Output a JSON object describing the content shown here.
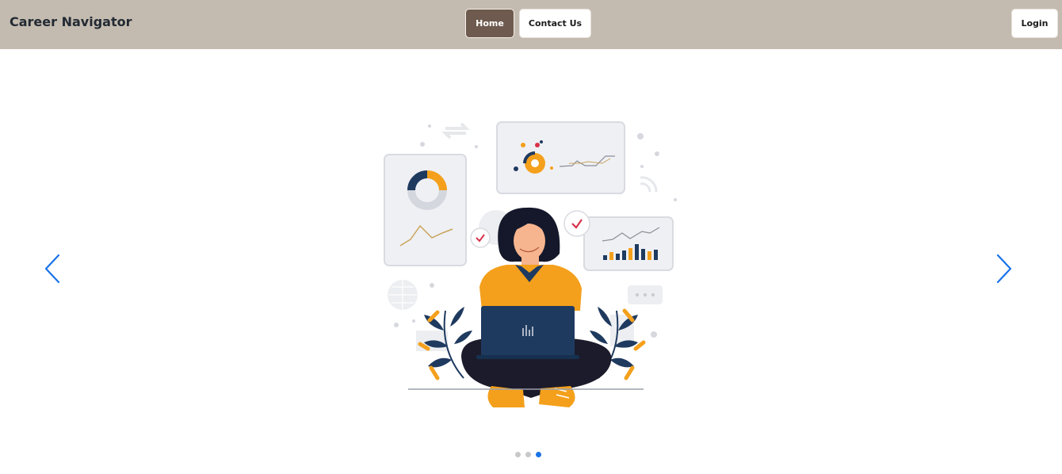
{
  "navbar": {
    "brand": "Career Navigator",
    "links": [
      {
        "label": "Home",
        "active": true
      },
      {
        "label": "Contact Us",
        "active": false
      }
    ],
    "login_label": "Login"
  },
  "carousel": {
    "prev_icon": "chevron-left-icon",
    "next_icon": "chevron-right-icon",
    "slide_count": 3,
    "active_slide": 3,
    "illustration": "person-with-laptop-analytics-illustration"
  },
  "colors": {
    "navbar_bg": "#c4bbb0",
    "home_button_bg": "#6e5a4e",
    "accent_arrow": "#1a73e8",
    "illustration_orange": "#f4a01c",
    "illustration_navy": "#1f3a5f"
  }
}
